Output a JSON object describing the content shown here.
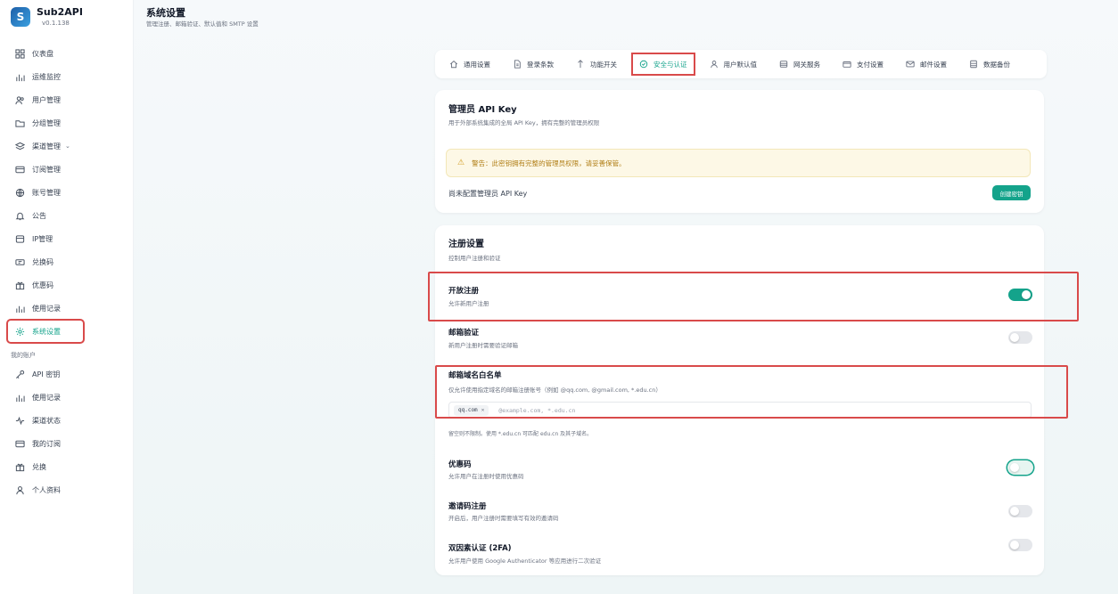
{
  "app": {
    "name": "Sub2API",
    "version": "v0.1.138"
  },
  "sidebar": {
    "items": [
      {
        "label": "仪表盘",
        "icon": "grid-icon"
      },
      {
        "label": "运维监控",
        "icon": "chart-icon"
      },
      {
        "label": "用户管理",
        "icon": "users-icon"
      },
      {
        "label": "分组管理",
        "icon": "folder-icon"
      },
      {
        "label": "渠道管理",
        "icon": "layers-icon"
      },
      {
        "label": "订阅管理",
        "icon": "card-icon"
      },
      {
        "label": "账号管理",
        "icon": "globe-icon"
      },
      {
        "label": "公告",
        "icon": "bell-icon"
      },
      {
        "label": "IP管理",
        "icon": "server-icon"
      },
      {
        "label": "兑换码",
        "icon": "ticket-icon"
      },
      {
        "label": "优惠码",
        "icon": "gift-icon"
      },
      {
        "label": "使用记录",
        "icon": "chart-icon"
      },
      {
        "label": "系统设置",
        "icon": "gear-icon"
      }
    ],
    "section_label": "我的账户",
    "account_items": [
      {
        "label": "API 密钥",
        "icon": "key-icon"
      },
      {
        "label": "使用记录",
        "icon": "chart-icon"
      },
      {
        "label": "渠道状态",
        "icon": "pulse-icon"
      },
      {
        "label": "我的订阅",
        "icon": "card-icon"
      },
      {
        "label": "兑换",
        "icon": "gift-icon"
      },
      {
        "label": "个人资料",
        "icon": "user-icon"
      }
    ]
  },
  "header": {
    "title": "系统设置",
    "subtitle": "管理注册、邮箱验证、默认值和 SMTP 设置"
  },
  "tabs": [
    {
      "label": "通用设置",
      "icon": "home-icon"
    },
    {
      "label": "登录条款",
      "icon": "document-icon"
    },
    {
      "label": "功能开关",
      "icon": "toggle-icon"
    },
    {
      "label": "安全与认证",
      "icon": "shield-icon"
    },
    {
      "label": "用户默认值",
      "icon": "user-icon"
    },
    {
      "label": "网关服务",
      "icon": "database-icon"
    },
    {
      "label": "支付设置",
      "icon": "wallet-icon"
    },
    {
      "label": "邮件设置",
      "icon": "mail-icon"
    },
    {
      "label": "数据备份",
      "icon": "backup-icon"
    }
  ],
  "api_key_card": {
    "title": "管理员 API Key",
    "subtitle": "用于外部系统集成的全局 API Key，拥有完整的管理员权限",
    "warning": "警告：此密钥拥有完整的管理员权限，请妥善保管。",
    "status": "尚未配置管理员 API Key",
    "create_label": "创建密钥"
  },
  "registration_card": {
    "title": "注册设置",
    "subtitle": "控制用户注册和验证",
    "open_registration": {
      "title": "开放注册",
      "desc": "允许新用户注册",
      "enabled": true
    },
    "email_verification": {
      "title": "邮箱验证",
      "desc": "新用户注册时需要验证邮箱",
      "enabled": false
    },
    "domain_whitelist": {
      "title": "邮箱域名白名单",
      "desc": "仅允许使用指定域名的邮箱注册账号（例如 @qq.com, @gmail.com, *.edu.cn）",
      "tags": [
        "qq.com"
      ],
      "placeholder": "@example.com, *.edu.cn",
      "hint": "留空则不限制。使用 *.edu.cn 可匹配 edu.cn 及其子域名。"
    },
    "promo_code": {
      "title": "优惠码",
      "desc": "允许用户在注册时使用优惠码",
      "enabled": false
    },
    "invite_registration": {
      "title": "邀请码注册",
      "desc": "开启后，用户注册时需要填写有效的邀请码",
      "enabled": false
    },
    "two_factor": {
      "title": "双因素认证 (2FA)",
      "desc": "允许用户使用 Google Authenticator 等应用进行二次验证",
      "enabled": false
    }
  },
  "colors": {
    "accent": "#14a38b",
    "highlight": "#d94a4a",
    "warning": "#b07d14"
  }
}
